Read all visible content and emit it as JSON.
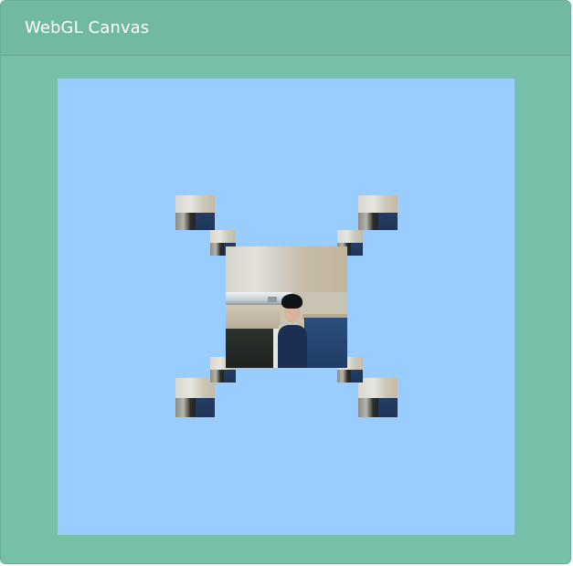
{
  "card": {
    "title": "WebGL Canvas"
  },
  "canvas": {
    "background_color": "#99ccff",
    "scene_description_icon": "textured-cube-scene"
  },
  "colors": {
    "card_bg": "#77c0a8",
    "header_bg": "#72b9a2",
    "title_text": "#ffffff"
  }
}
